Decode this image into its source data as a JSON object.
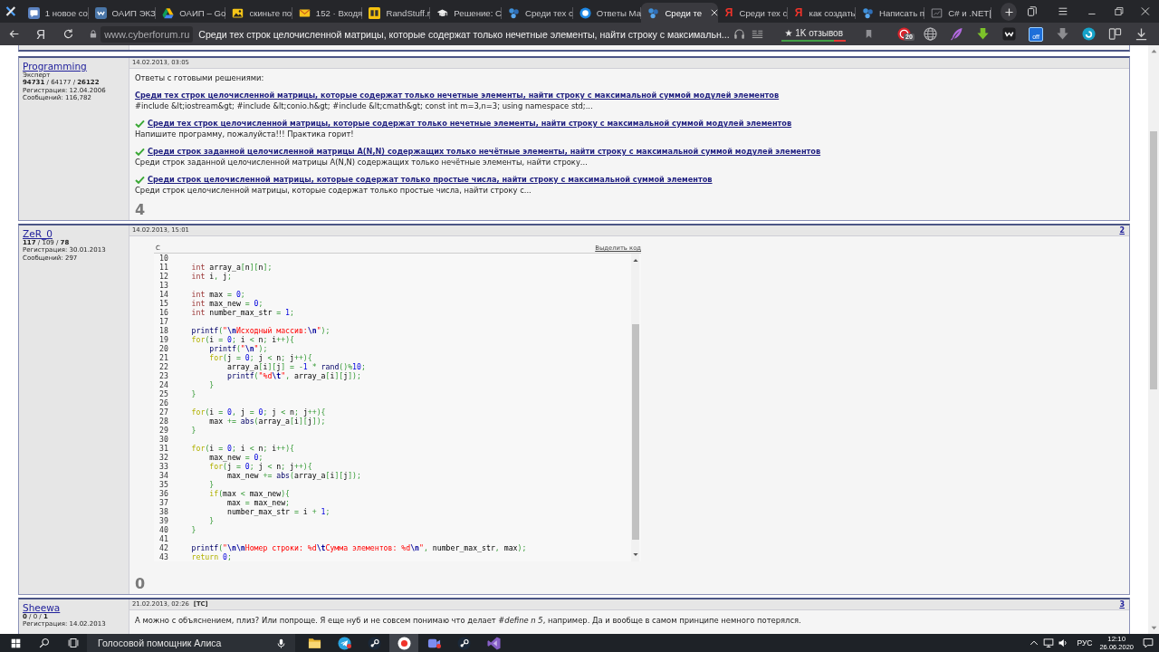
{
  "browser": {
    "tabs": [
      {
        "title": "1 новое со",
        "kind": "bubble",
        "selected": false
      },
      {
        "title": "ОАИП ЭКЗ",
        "kind": "vk",
        "selected": false
      },
      {
        "title": "ОАИП – Go",
        "kind": "triangle",
        "selected": false
      },
      {
        "title": "скиньте по",
        "kind": "picture",
        "selected": false
      },
      {
        "title": "152 · Входя",
        "kind": "envelope",
        "selected": false
      },
      {
        "title": "RandStuff.r",
        "kind": "tile",
        "selected": false
      },
      {
        "title": "Решение: С",
        "kind": "cap",
        "selected": false
      },
      {
        "title": "Среди тех с",
        "kind": "circles",
        "selected": false
      },
      {
        "title": "Ответы Ма",
        "kind": "ring",
        "selected": false
      },
      {
        "title": "Среди те",
        "kind": "circles",
        "selected": true
      },
      {
        "title": "Среди тех с",
        "kind": "letter",
        "letter": "Я",
        "selected": false
      },
      {
        "title": "как создать",
        "kind": "letter",
        "letter": "Я",
        "selected": false
      },
      {
        "title": "Написать п",
        "kind": "circles",
        "selected": false
      },
      {
        "title": "C# и .NET|",
        "kind": "square",
        "selected": false
      }
    ]
  },
  "address_bar": {
    "home_label": "Я",
    "url": "www.cyberforum.ru",
    "page_title": "Среди тех строк целочисленной матрицы, которые содержат только нечетные элементы, найти строку с максимальн...",
    "reviews": "★ 1K отзывов",
    "badge": "20",
    "toggle_label": "off"
  },
  "posts": [
    {
      "author": "Programming",
      "rank": "Эксперт",
      "stats": "**94731** / 64177 / **26122**",
      "registered": "Регистрация: 12.04.2006",
      "messages": "Сообщений: 116,782",
      "date": "14.02.2013, 03:05",
      "intro": "Ответы с готовыми решениями:",
      "answers": [
        {
          "title": "Среди тех строк целочисленной матрицы, которые содержат только нечетные элементы, найти строку с максимальной суммой модулей элементов",
          "snippet": "#include &lt;iostream&gt; #include &lt;conio.h&gt; #include &lt;cmath&gt; const int m=3,n=3; using namespace std;...",
          "solved": false
        },
        {
          "title": "Среди тех строк целочисленной матрицы, которые содержат только нечетные элементы, найти строку с максимальной суммой модулей элементов",
          "snippet": "Напишите программу, пожалуйста!!! Практика горит!",
          "solved": true
        },
        {
          "title": "Среди строк заданной целочисленной матрицы A(N,N) содержащих только нечётные элементы, найти строку с максимальной суммой модулей элементов",
          "snippet": "Среди строк заданной целочисленной матрицы A(N,N) содержащих только нечётные элементы, найти строку...",
          "solved": true
        },
        {
          "title": "Среди строк целочисленной матрицы, которые содержат только простые числа, найти строку с максимальной суммой элементов",
          "snippet": "Среди строк целочисленной матрицы, которые содержат только простые числа, найти строку с...",
          "solved": true
        }
      ],
      "rating": "4"
    },
    {
      "author": "ZeR_0",
      "stats": "**117** / 109 / **78**",
      "registered": "Регистрация: 30.01.2013",
      "messages": "Сообщений: 297",
      "date": "14.02.2013, 15:01",
      "number": "2",
      "code": {
        "language": "C",
        "select_label": "Выделить код",
        "lines": [
          {
            "number": "10"
          },
          {
            "number": "11",
            "tokens": [
              {
                "kind": "type",
                "text": "    int"
              },
              {
                "kind": "text",
                "text": " array_a"
              },
              {
                "kind": "symbol",
                "text": "["
              },
              {
                "kind": "text",
                "text": "n"
              },
              {
                "kind": "symbol",
                "text": "]["
              },
              {
                "kind": "text",
                "text": "n"
              },
              {
                "kind": "symbol",
                "text": "];"
              }
            ]
          },
          {
            "number": "12",
            "tokens": [
              {
                "kind": "type",
                "text": "    int"
              },
              {
                "kind": "text",
                "text": " i"
              },
              {
                "kind": "symbol",
                "text": ","
              },
              {
                "kind": "text",
                "text": " j"
              },
              {
                "kind": "symbol",
                "text": ";"
              }
            ]
          },
          {
            "number": "13"
          },
          {
            "number": "14",
            "tokens": [
              {
                "kind": "type",
                "text": "    int"
              },
              {
                "kind": "text",
                "text": " max "
              },
              {
                "kind": "symbol",
                "text": "= "
              },
              {
                "kind": "number",
                "text": "0"
              },
              {
                "kind": "symbol",
                "text": ";"
              }
            ]
          },
          {
            "number": "15",
            "tokens": [
              {
                "kind": "type",
                "text": "    int"
              },
              {
                "kind": "text",
                "text": " max_new "
              },
              {
                "kind": "symbol",
                "text": "= "
              },
              {
                "kind": "number",
                "text": "0"
              },
              {
                "kind": "symbol",
                "text": ";"
              }
            ]
          },
          {
            "number": "16",
            "tokens": [
              {
                "kind": "type",
                "text": "    int"
              },
              {
                "kind": "text",
                "text": " number_max_str "
              },
              {
                "kind": "symbol",
                "text": "= "
              },
              {
                "kind": "number",
                "text": "1"
              },
              {
                "kind": "symbol",
                "text": ";"
              }
            ]
          },
          {
            "number": "17"
          },
          {
            "number": "18",
            "tokens": [
              {
                "kind": "function",
                "text": "    printf"
              },
              {
                "kind": "symbol",
                "text": "("
              },
              {
                "kind": "string",
                "text": "\""
              },
              {
                "kind": "escape",
                "text": "\\n"
              },
              {
                "kind": "string",
                "text": "Исходный массив:"
              },
              {
                "kind": "escape",
                "text": "\\n"
              },
              {
                "kind": "string",
                "text": "\""
              },
              {
                "kind": "symbol",
                "text": ");"
              }
            ]
          },
          {
            "number": "19",
            "tokens": [
              {
                "kind": "keyword",
                "text": "    for"
              },
              {
                "kind": "symbol",
                "text": "("
              },
              {
                "kind": "text",
                "text": "i "
              },
              {
                "kind": "symbol",
                "text": "= "
              },
              {
                "kind": "number",
                "text": "0"
              },
              {
                "kind": "symbol",
                "text": ";"
              },
              {
                "kind": "text",
                "text": " i "
              },
              {
                "kind": "symbol",
                "text": "<"
              },
              {
                "kind": "text",
                "text": " n"
              },
              {
                "kind": "symbol",
                "text": ";"
              },
              {
                "kind": "text",
                "text": " i"
              },
              {
                "kind": "symbol",
                "text": "++){"
              }
            ]
          },
          {
            "number": "20",
            "tokens": [
              {
                "kind": "function",
                "text": "        printf"
              },
              {
                "kind": "symbol",
                "text": "("
              },
              {
                "kind": "string",
                "text": "\""
              },
              {
                "kind": "escape",
                "text": "\\n"
              },
              {
                "kind": "string",
                "text": "\""
              },
              {
                "kind": "symbol",
                "text": ");"
              }
            ]
          },
          {
            "number": "21",
            "tokens": [
              {
                "kind": "keyword",
                "text": "        for"
              },
              {
                "kind": "symbol",
                "text": "("
              },
              {
                "kind": "text",
                "text": "j "
              },
              {
                "kind": "symbol",
                "text": "= "
              },
              {
                "kind": "number",
                "text": "0"
              },
              {
                "kind": "symbol",
                "text": ";"
              },
              {
                "kind": "text",
                "text": " j "
              },
              {
                "kind": "symbol",
                "text": "<"
              },
              {
                "kind": "text",
                "text": " n"
              },
              {
                "kind": "symbol",
                "text": ";"
              },
              {
                "kind": "text",
                "text": " j"
              },
              {
                "kind": "symbol",
                "text": "++){"
              }
            ]
          },
          {
            "number": "22",
            "tokens": [
              {
                "kind": "text",
                "text": "            array_a"
              },
              {
                "kind": "symbol",
                "text": "["
              },
              {
                "kind": "text",
                "text": "i"
              },
              {
                "kind": "symbol",
                "text": "]["
              },
              {
                "kind": "text",
                "text": "j"
              },
              {
                "kind": "symbol",
                "text": "] = -"
              },
              {
                "kind": "number",
                "text": "1"
              },
              {
                "kind": "symbol",
                "text": " * "
              },
              {
                "kind": "function",
                "text": "rand"
              },
              {
                "kind": "symbol",
                "text": "()%"
              },
              {
                "kind": "number",
                "text": "10"
              },
              {
                "kind": "symbol",
                "text": ";"
              }
            ]
          },
          {
            "number": "23",
            "tokens": [
              {
                "kind": "function",
                "text": "            printf"
              },
              {
                "kind": "symbol",
                "text": "("
              },
              {
                "kind": "string",
                "text": "\"%d"
              },
              {
                "kind": "escape",
                "text": "\\t"
              },
              {
                "kind": "string",
                "text": "\""
              },
              {
                "kind": "symbol",
                "text": ","
              },
              {
                "kind": "text",
                "text": " array_a"
              },
              {
                "kind": "symbol",
                "text": "["
              },
              {
                "kind": "text",
                "text": "i"
              },
              {
                "kind": "symbol",
                "text": "]["
              },
              {
                "kind": "text",
                "text": "j"
              },
              {
                "kind": "symbol",
                "text": "]);"
              }
            ]
          },
          {
            "number": "24",
            "tokens": [
              {
                "kind": "symbol",
                "text": "        }"
              }
            ]
          },
          {
            "number": "25",
            "tokens": [
              {
                "kind": "symbol",
                "text": "    }"
              }
            ]
          },
          {
            "number": "26"
          },
          {
            "number": "27",
            "tokens": [
              {
                "kind": "keyword",
                "text": "    for"
              },
              {
                "kind": "symbol",
                "text": "("
              },
              {
                "kind": "text",
                "text": "i "
              },
              {
                "kind": "symbol",
                "text": "= "
              },
              {
                "kind": "number",
                "text": "0"
              },
              {
                "kind": "symbol",
                "text": ","
              },
              {
                "kind": "text",
                "text": " j "
              },
              {
                "kind": "symbol",
                "text": "= "
              },
              {
                "kind": "number",
                "text": "0"
              },
              {
                "kind": "symbol",
                "text": ";"
              },
              {
                "kind": "text",
                "text": " j "
              },
              {
                "kind": "symbol",
                "text": "<"
              },
              {
                "kind": "text",
                "text": " n"
              },
              {
                "kind": "symbol",
                "text": ";"
              },
              {
                "kind": "text",
                "text": " j"
              },
              {
                "kind": "symbol",
                "text": "++){"
              }
            ]
          },
          {
            "number": "28",
            "tokens": [
              {
                "kind": "text",
                "text": "        max "
              },
              {
                "kind": "symbol",
                "text": "+= "
              },
              {
                "kind": "function",
                "text": "abs"
              },
              {
                "kind": "symbol",
                "text": "("
              },
              {
                "kind": "text",
                "text": "array_a"
              },
              {
                "kind": "symbol",
                "text": "["
              },
              {
                "kind": "text",
                "text": "i"
              },
              {
                "kind": "symbol",
                "text": "]["
              },
              {
                "kind": "text",
                "text": "j"
              },
              {
                "kind": "symbol",
                "text": "]);"
              }
            ]
          },
          {
            "number": "29",
            "tokens": [
              {
                "kind": "symbol",
                "text": "    }"
              }
            ]
          },
          {
            "number": "30"
          },
          {
            "number": "31",
            "tokens": [
              {
                "kind": "keyword",
                "text": "    for"
              },
              {
                "kind": "symbol",
                "text": "("
              },
              {
                "kind": "text",
                "text": "i "
              },
              {
                "kind": "symbol",
                "text": "= "
              },
              {
                "kind": "number",
                "text": "0"
              },
              {
                "kind": "symbol",
                "text": ";"
              },
              {
                "kind": "text",
                "text": " i "
              },
              {
                "kind": "symbol",
                "text": "<"
              },
              {
                "kind": "text",
                "text": " n"
              },
              {
                "kind": "symbol",
                "text": ";"
              },
              {
                "kind": "text",
                "text": " i"
              },
              {
                "kind": "symbol",
                "text": "++){"
              }
            ]
          },
          {
            "number": "32",
            "tokens": [
              {
                "kind": "text",
                "text": "        max_new "
              },
              {
                "kind": "symbol",
                "text": "= "
              },
              {
                "kind": "number",
                "text": "0"
              },
              {
                "kind": "symbol",
                "text": ";"
              }
            ]
          },
          {
            "number": "33",
            "tokens": [
              {
                "kind": "keyword",
                "text": "        for"
              },
              {
                "kind": "symbol",
                "text": "("
              },
              {
                "kind": "text",
                "text": "j "
              },
              {
                "kind": "symbol",
                "text": "= "
              },
              {
                "kind": "number",
                "text": "0"
              },
              {
                "kind": "symbol",
                "text": ";"
              },
              {
                "kind": "text",
                "text": " j "
              },
              {
                "kind": "symbol",
                "text": "<"
              },
              {
                "kind": "text",
                "text": " n"
              },
              {
                "kind": "symbol",
                "text": ";"
              },
              {
                "kind": "text",
                "text": " j"
              },
              {
                "kind": "symbol",
                "text": "++){"
              }
            ]
          },
          {
            "number": "34",
            "tokens": [
              {
                "kind": "text",
                "text": "            max_new "
              },
              {
                "kind": "symbol",
                "text": "+= "
              },
              {
                "kind": "function",
                "text": "abs"
              },
              {
                "kind": "symbol",
                "text": "("
              },
              {
                "kind": "text",
                "text": "array_a"
              },
              {
                "kind": "symbol",
                "text": "["
              },
              {
                "kind": "text",
                "text": "i"
              },
              {
                "kind": "symbol",
                "text": "]["
              },
              {
                "kind": "text",
                "text": "j"
              },
              {
                "kind": "symbol",
                "text": "]);"
              }
            ]
          },
          {
            "number": "35",
            "tokens": [
              {
                "kind": "symbol",
                "text": "        }"
              }
            ]
          },
          {
            "number": "36",
            "tokens": [
              {
                "kind": "keyword",
                "text": "        if"
              },
              {
                "kind": "symbol",
                "text": "("
              },
              {
                "kind": "text",
                "text": "max "
              },
              {
                "kind": "symbol",
                "text": "<"
              },
              {
                "kind": "text",
                "text": " max_new"
              },
              {
                "kind": "symbol",
                "text": "){"
              }
            ]
          },
          {
            "number": "37",
            "tokens": [
              {
                "kind": "text",
                "text": "            max "
              },
              {
                "kind": "symbol",
                "text": "="
              },
              {
                "kind": "text",
                "text": " max_new"
              },
              {
                "kind": "symbol",
                "text": ";"
              }
            ]
          },
          {
            "number": "38",
            "tokens": [
              {
                "kind": "text",
                "text": "            number_max_str "
              },
              {
                "kind": "symbol",
                "text": "="
              },
              {
                "kind": "text",
                "text": " i "
              },
              {
                "kind": "symbol",
                "text": "+ "
              },
              {
                "kind": "number",
                "text": "1"
              },
              {
                "kind": "symbol",
                "text": ";"
              }
            ]
          },
          {
            "number": "39",
            "tokens": [
              {
                "kind": "symbol",
                "text": "        }"
              }
            ]
          },
          {
            "number": "40",
            "tokens": [
              {
                "kind": "symbol",
                "text": "    }"
              }
            ]
          },
          {
            "number": "41"
          },
          {
            "number": "42",
            "tokens": [
              {
                "kind": "function",
                "text": "    printf"
              },
              {
                "kind": "symbol",
                "text": "("
              },
              {
                "kind": "string",
                "text": "\""
              },
              {
                "kind": "escape",
                "text": "\\n\\n"
              },
              {
                "kind": "string",
                "text": "Номер строки: %d"
              },
              {
                "kind": "escape",
                "text": "\\t"
              },
              {
                "kind": "string",
                "text": "Сумма элементов: %d"
              },
              {
                "kind": "escape",
                "text": "\\n"
              },
              {
                "kind": "string",
                "text": "\""
              },
              {
                "kind": "symbol",
                "text": ","
              },
              {
                "kind": "text",
                "text": " number_max_str"
              },
              {
                "kind": "symbol",
                "text": ","
              },
              {
                "kind": "text",
                "text": " max"
              },
              {
                "kind": "symbol",
                "text": ");"
              }
            ]
          },
          {
            "number": "43",
            "tokens": [
              {
                "kind": "keyword",
                "text": "    return"
              },
              {
                "kind": "number",
                "text": " 0"
              },
              {
                "kind": "symbol",
                "text": ";"
              }
            ]
          }
        ]
      },
      "rating": "0"
    },
    {
      "author": "Sheewa",
      "stats": "**0** / 0 / **1**",
      "registered": "Регистрация: 14.02.2013",
      "date": "21.02.2013, 02:26",
      "starter_tag": "[TC]",
      "number": "3",
      "text": "А можно с объяснением, плиз? Или попроще. Я еще нуб и не совсем понимаю что делает *#define n 5*, например. Да и вообще в самом принципе немного потерялся."
    }
  ],
  "taskbar": {
    "voice_field": {
      "placeholder": "Голосовой помощник Алиса"
    },
    "apps": [
      {
        "kind": "folder",
        "selected": false,
        "notification": false
      },
      {
        "kind": "plane",
        "selected": false,
        "notification": true
      },
      {
        "kind": "steam",
        "selected": false,
        "notification": false
      },
      {
        "kind": "browser",
        "selected": true,
        "notification": false
      },
      {
        "kind": "camera",
        "selected": false,
        "notification": true
      },
      {
        "kind": "steam",
        "selected": false,
        "notification": false
      },
      {
        "kind": "ide",
        "selected": false,
        "notification": false
      }
    ],
    "language": "РУС",
    "time": "12:10",
    "date": "26.06.2020"
  }
}
